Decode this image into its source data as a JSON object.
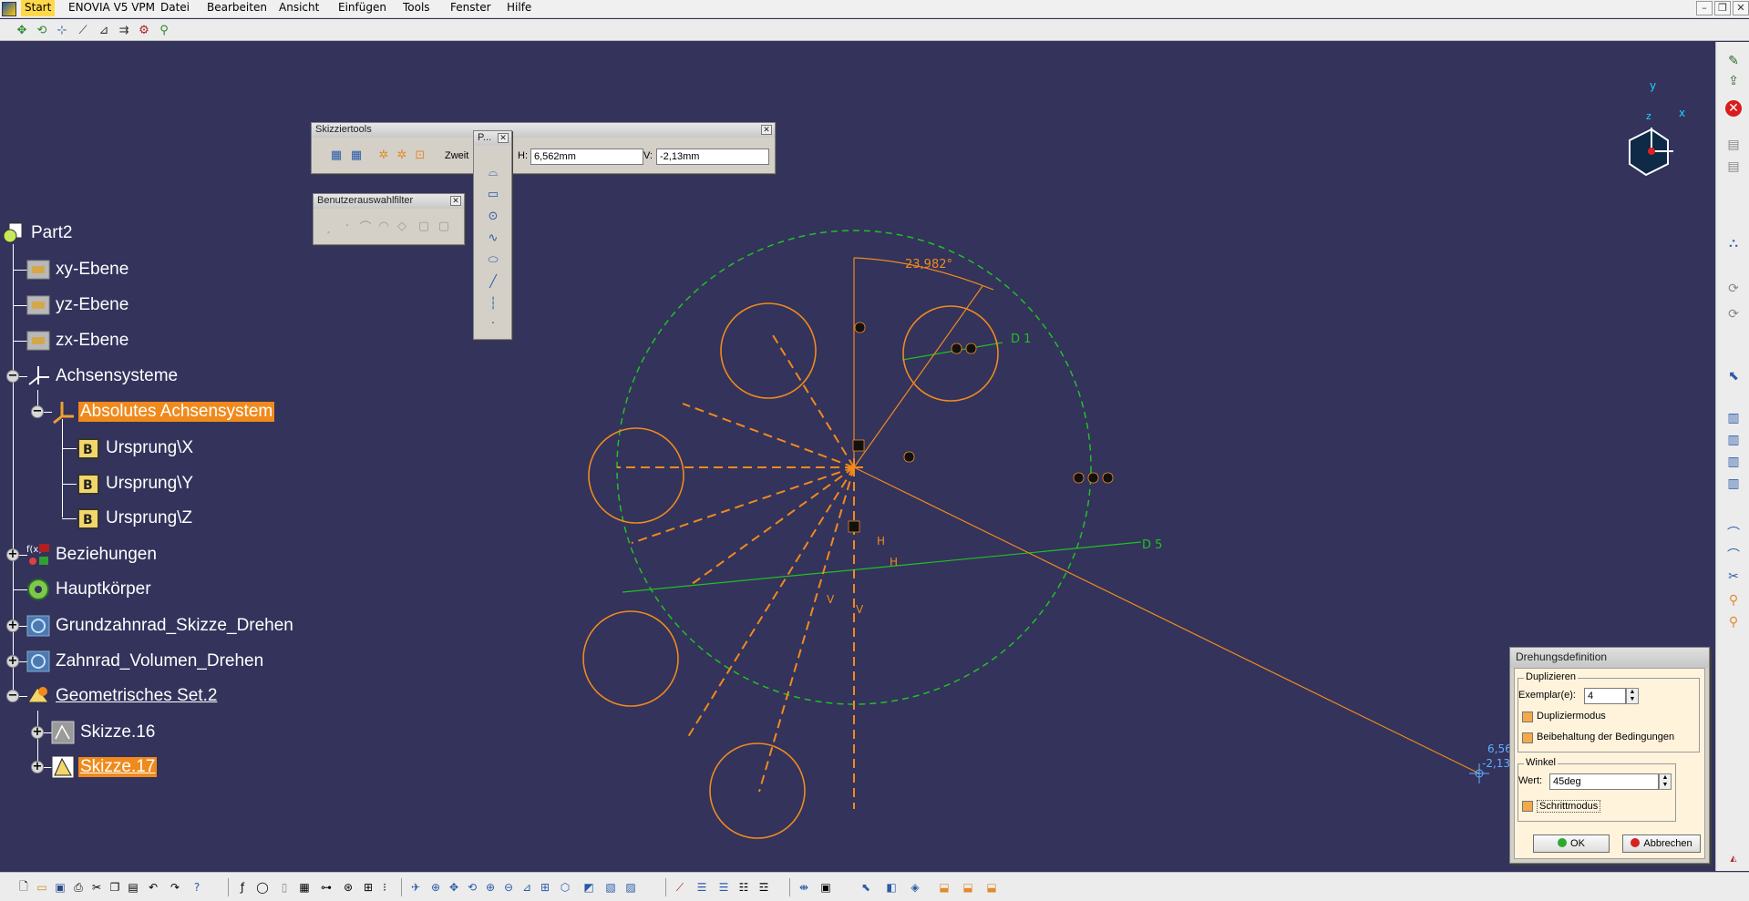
{
  "menubar": {
    "items": [
      "Start",
      "ENOVIA V5 VPM",
      "Datei",
      "Bearbeiten",
      "Ansicht",
      "Einfügen",
      "Tools",
      "Fenster",
      "Hilfe"
    ],
    "active_item": "Start",
    "window_controls": [
      "–",
      "❐",
      "✕"
    ]
  },
  "tree": {
    "root": "Part2",
    "items": [
      {
        "label": "xy-Ebene",
        "icon": "plane-icon"
      },
      {
        "label": "yz-Ebene",
        "icon": "plane-icon"
      },
      {
        "label": "zx-Ebene",
        "icon": "plane-icon"
      },
      {
        "label": "Achsensysteme",
        "icon": "axis-system-icon"
      },
      {
        "label": "Absolutes Achsensystem",
        "icon": "axis-icon",
        "highlighted": true
      },
      {
        "label": "Ursprung\\X",
        "icon": "axis-direction-icon"
      },
      {
        "label": "Ursprung\\Y",
        "icon": "axis-direction-icon"
      },
      {
        "label": "Ursprung\\Z",
        "icon": "axis-direction-icon"
      },
      {
        "label": "Beziehungen",
        "icon": "relations-icon"
      },
      {
        "label": "Hauptkörper",
        "icon": "body-icon"
      },
      {
        "label": "Grundzahnrad_Skizze_Drehen",
        "icon": "shaft-icon"
      },
      {
        "label": "Zahnrad_Volumen_Drehen",
        "icon": "shaft-icon"
      },
      {
        "label": "Geometrisches Set.2",
        "icon": "geometrical-set-icon",
        "underline": true
      },
      {
        "label": "Skizze.16",
        "icon": "sketch-icon"
      },
      {
        "label": "Skizze.17",
        "icon": "sketch-active-icon",
        "highlighted": true,
        "underline": true
      }
    ]
  },
  "skizziertools": {
    "title": "Skizziertools",
    "mode_text": "Zweit",
    "h_label": "H:",
    "h_value": "6,562mm",
    "v_label": "V:",
    "v_value": "-2,13mm"
  },
  "profile_palette": {
    "title": "P..."
  },
  "benutzerauswahlfilter": {
    "title": "Benutzerauswahlfilter"
  },
  "sketch": {
    "angle_label": "23,982°",
    "d1_label": "D 1",
    "d5_label": "D 5",
    "h_label": "H",
    "v_label": "V",
    "cursor_h": "6,56",
    "cursor_v": "-2,13",
    "compass_x": "x",
    "compass_y": "y",
    "compass_z": "z"
  },
  "dialog": {
    "title": "Drehungsdefinition",
    "duplizieren_group": "Duplizieren",
    "exemplare_label": "Exemplar(e):",
    "exemplare_value": "4",
    "dupliziermodus_label": "Dupliziermodus",
    "beibehaltung_label": "Beibehaltung der Bedingungen",
    "winkel_group": "Winkel",
    "wert_label": "Wert:",
    "wert_value": "45deg",
    "schrittmodus_label": "Schrittmodus",
    "ok_label": "OK",
    "abbrechen_label": "Abbrechen"
  },
  "colors": {
    "viewport_bg": "#33335c",
    "sketch_orange": "#f08a1c",
    "construction_green": "#22c022",
    "highlight": "#f08a1c"
  }
}
